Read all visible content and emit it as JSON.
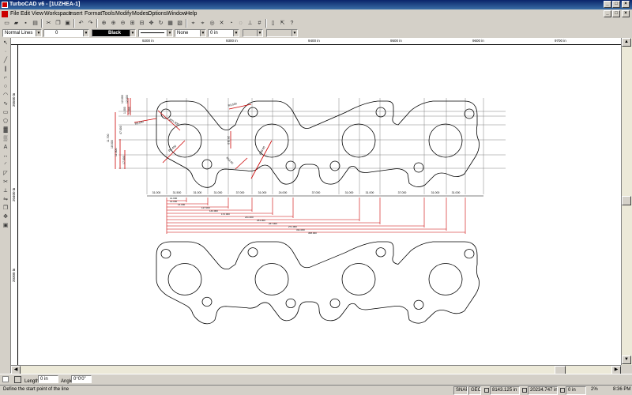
{
  "app": {
    "title": "TurboCAD v6 - [1UZHEA-1]"
  },
  "menu": [
    "File",
    "Edit",
    "View",
    "Workspace",
    "Insert",
    "Format",
    "Tools",
    "Modify",
    "Modes",
    "Options",
    "Window",
    "Help"
  ],
  "property_bar": {
    "line_style": "Normal Lines",
    "line_width": "0",
    "color": "Black",
    "pattern": "None",
    "thickness": "0 in"
  },
  "rulers": {
    "horizontal": [
      "9200 in",
      "9300 in",
      "9400 in",
      "9500 in",
      "9600 in",
      "9700 in"
    ],
    "vertical": [
      "20500 in",
      "20400 in",
      "20300 in"
    ]
  },
  "drawing": {
    "dim_labels_top": [
      "12.000",
      "1.000",
      "12.000",
      "1.000"
    ],
    "dim_labels_left": [
      "11.700",
      "18.000",
      "11.000",
      "47.000",
      "17.000"
    ],
    "radial_labels": [
      "Ø21.000",
      "R3.500",
      "Ø1.400",
      "R3.500",
      "Ø39.00",
      "20.310",
      "R13.00"
    ],
    "baseline_labels": [
      "31.000",
      "31.500",
      "31.000",
      "31.000",
      "37.000",
      "31.000",
      "24.000",
      "37.000",
      "31.000",
      "31.000",
      "37.000",
      "31.000",
      "31.000"
    ],
    "chain_labels": [
      "14.000",
      "14.000",
      "14.000",
      "117.000",
      "143.000",
      "172.000",
      "211.000",
      "253.000",
      "267.000",
      "271.000",
      "311.000",
      "368.000"
    ]
  },
  "inspector": {
    "length_label": "Length",
    "length_value": "0 in",
    "angle_label": "Angle",
    "angle_value": "0°0'0\""
  },
  "status": {
    "prompt": "Define the start point of the line",
    "snap": "SNAP",
    "geo": "GEO",
    "x": "8143.125 in",
    "y": "20234.747 in",
    "z": "0 in",
    "zoom": "2%",
    "time": "8:36 PM"
  }
}
